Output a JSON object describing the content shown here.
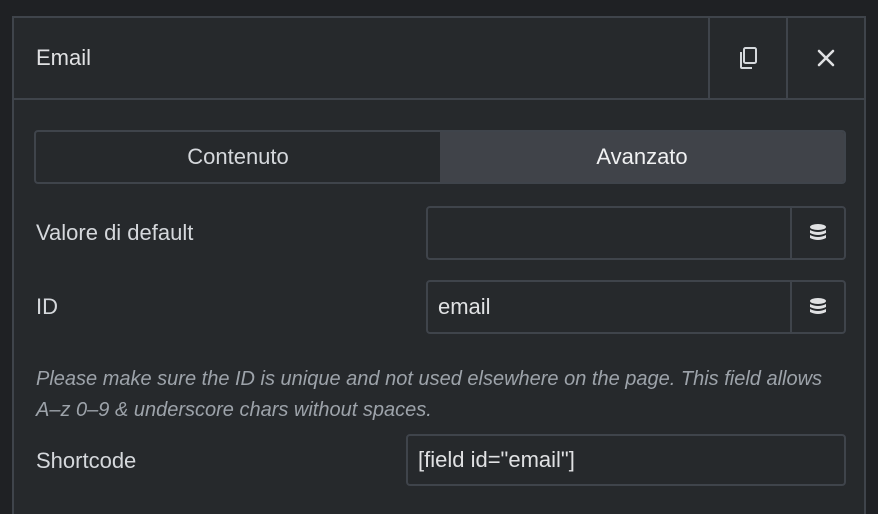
{
  "header": {
    "title": "Email",
    "copy_icon": "copy-icon",
    "close_icon": "close-icon"
  },
  "tabs": [
    {
      "label": "Contenuto",
      "active": false
    },
    {
      "label": "Avanzato",
      "active": true
    }
  ],
  "fields": {
    "default_value": {
      "label": "Valore di default",
      "value": "",
      "icon": "database-icon"
    },
    "id": {
      "label": "ID",
      "value": "email",
      "icon": "database-icon"
    }
  },
  "help_text": "Please make sure the ID is unique and not used elsewhere on the page. This field allows A–z  0–9 & underscore chars without spaces.",
  "shortcode": {
    "label": "Shortcode",
    "value": "[field id=\"email\"]"
  },
  "colors": {
    "background": "#26292c",
    "border": "#3f444b",
    "active_tab": "#404349",
    "help_text": "#9da3aa"
  }
}
